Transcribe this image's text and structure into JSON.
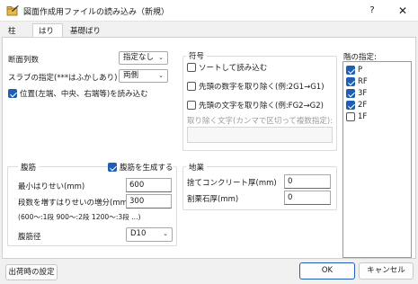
{
  "window": {
    "title": "図面作成用ファイルの読み込み（新規）",
    "help_label": "?",
    "close_label": "✕"
  },
  "tabs": [
    "柱",
    "はり",
    "基礎ばり"
  ],
  "left": {
    "section_count_label": "断面列数",
    "section_count_value": "指定なし",
    "slab_label": "スラブの指定(***はふかしあり)",
    "slab_value": "両側",
    "position_read_label": "位置(左端、中央、右端等)を読み込む"
  },
  "symbol": {
    "title": "符号",
    "sort_label": "ソートして読み込む",
    "remove_leading_digit_label": "先頭の数字を取り除く(例:2G1→G1)",
    "remove_leading_char_label": "先頭の文字を取り除く(例:FG2→G2)",
    "remove_chars_label": "取り除く文字(カンマで区切って複数指定):",
    "remove_chars_value": ""
  },
  "stirrup": {
    "title": "腹筋",
    "generate_label": "腹筋を生成する",
    "min_height_label": "最小はりせい(mm)",
    "min_height_value": "600",
    "increment_label": "段数を増すはりせいの増分(mm)",
    "increment_value": "300",
    "note": "(600〜:1段 900〜:2段 1200〜:3段 ...)",
    "diameter_label": "腹筋径",
    "diameter_value": "D10"
  },
  "foundation": {
    "title": "地業",
    "concrete_label": "捨てコンクリート厚(mm)",
    "concrete_value": "0",
    "gravel_label": "割栗石厚(mm)",
    "gravel_value": "0"
  },
  "floors": {
    "title": "階の指定:",
    "items": [
      {
        "label": "P",
        "checked": true
      },
      {
        "label": "RF",
        "checked": true
      },
      {
        "label": "3F",
        "checked": true
      },
      {
        "label": "2F",
        "checked": true
      },
      {
        "label": "1F",
        "checked": false
      }
    ]
  },
  "footer": {
    "defaults_label": "出荷時の設定",
    "ok_label": "OK",
    "cancel_label": "キャンセル"
  },
  "colors": {
    "accent": "#1e5fb4"
  }
}
